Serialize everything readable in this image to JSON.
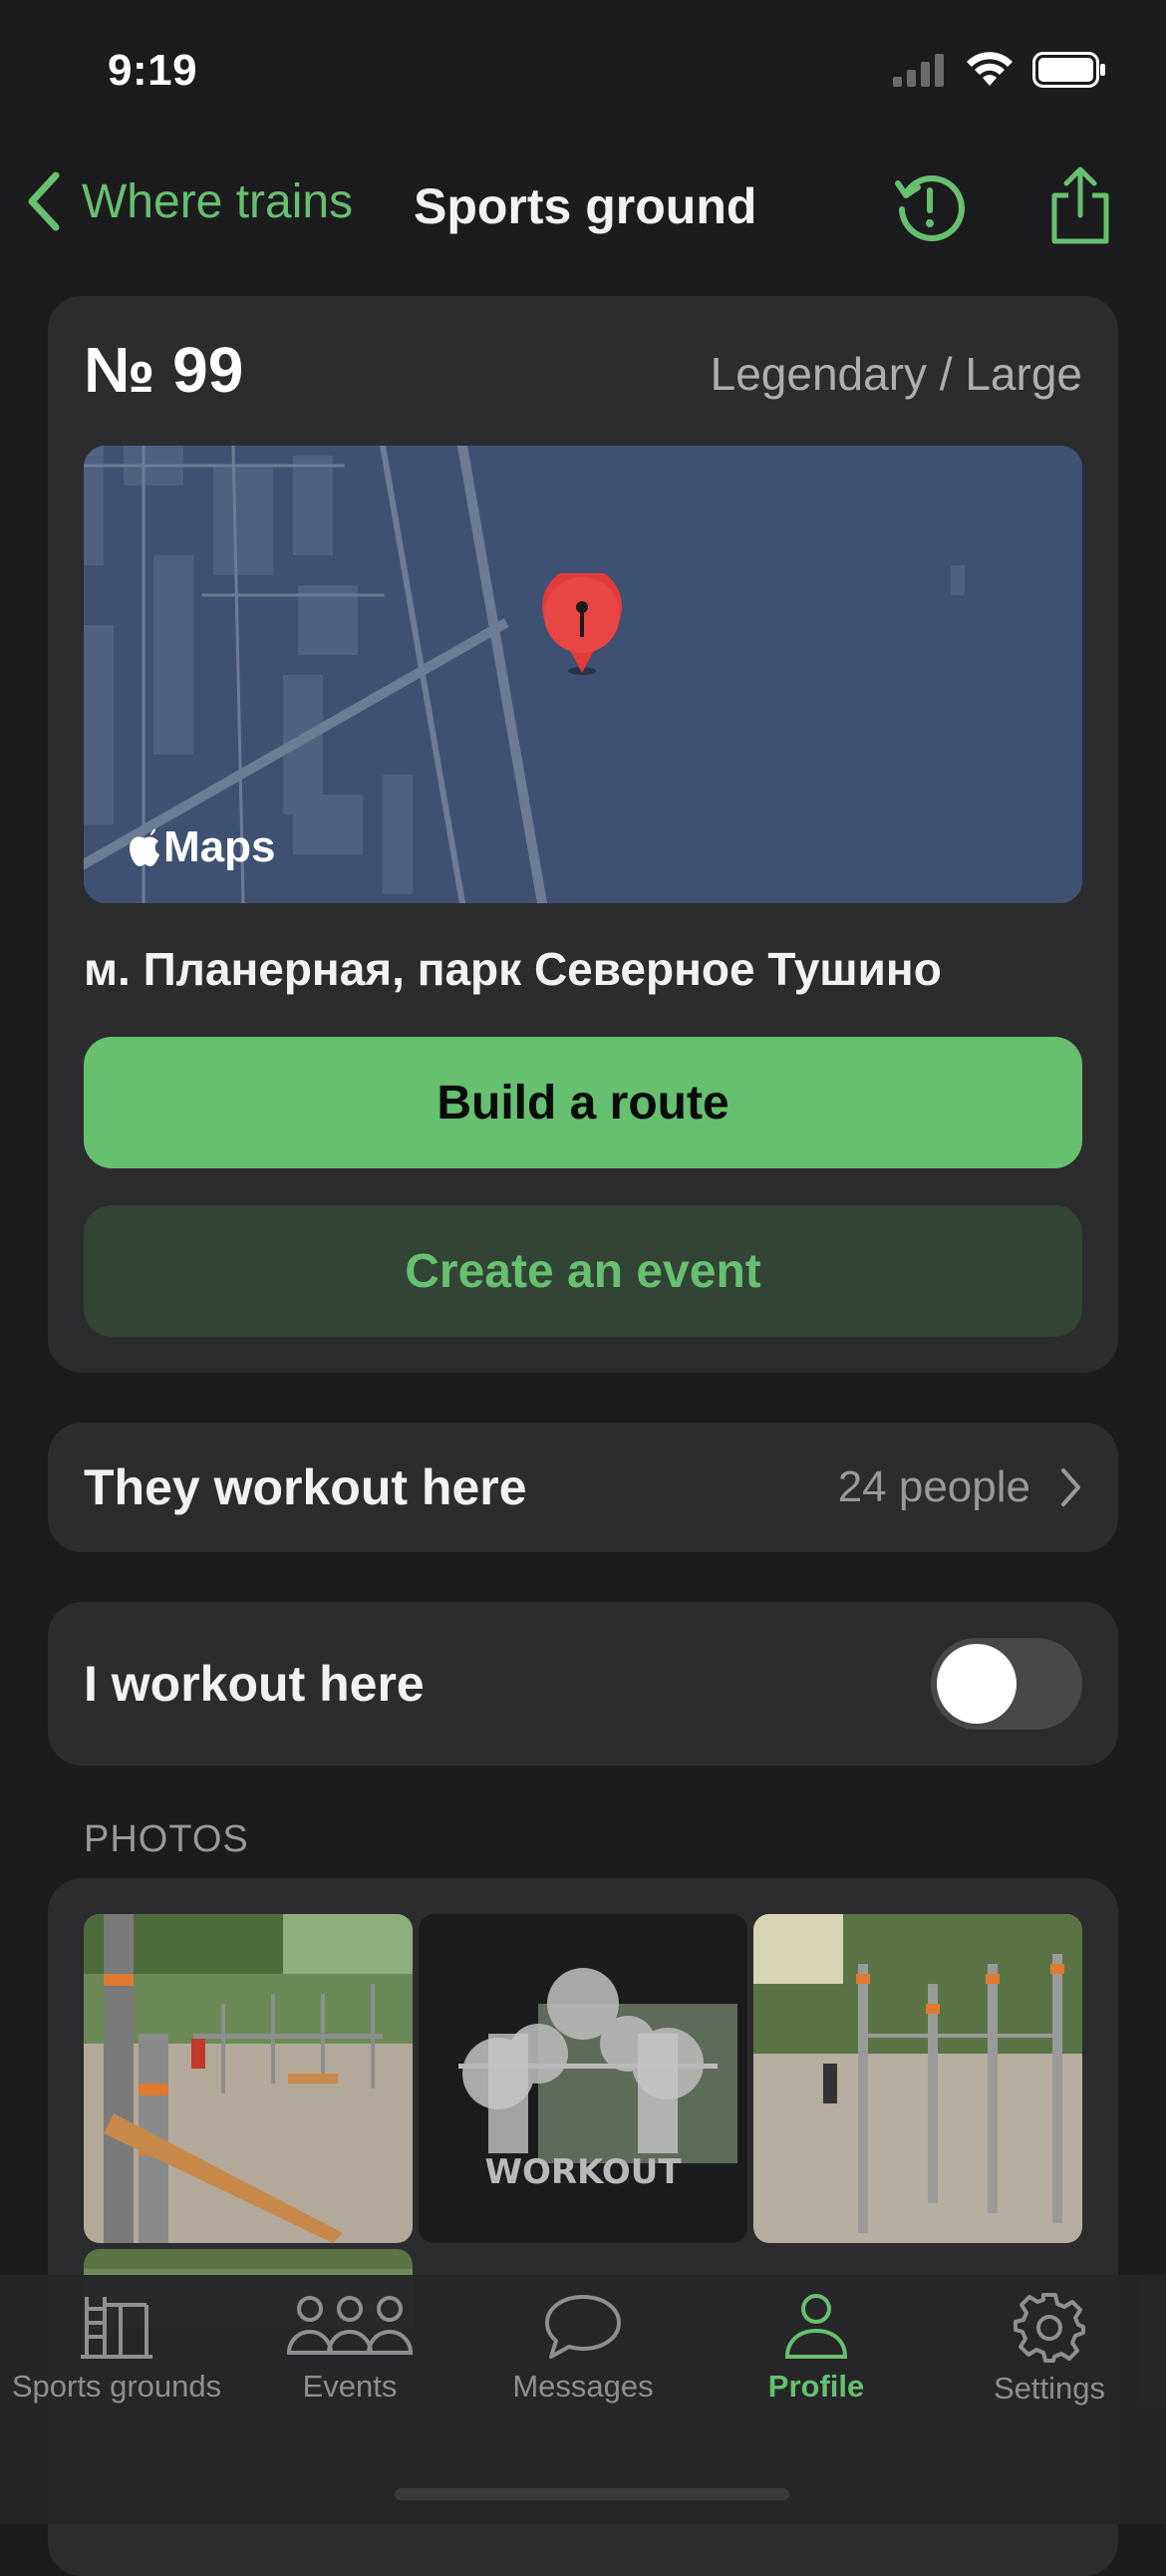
{
  "status_bar": {
    "time": "9:19",
    "icons": [
      "cellular-signal-icon",
      "wifi-icon",
      "battery-icon"
    ]
  },
  "nav": {
    "back_label": "Where trains",
    "title": "Sports ground",
    "actions": [
      "report-icon",
      "share-icon"
    ]
  },
  "ground": {
    "number": "№ 99",
    "grade": "Legendary / Large",
    "map_brand": "Maps",
    "address": "м. Планерная, парк Северное Тушино",
    "route_button": "Build a route",
    "event_button": "Create an event"
  },
  "workout_here": {
    "label": "They workout here",
    "count": "24 people"
  },
  "toggle": {
    "label": "I workout here",
    "on": false
  },
  "photos": {
    "header": "PHOTOS",
    "placeholder_logo_text": "WorkOut"
  },
  "tabs": [
    {
      "label": "Sports grounds",
      "icon": "ladder-icon",
      "active": false
    },
    {
      "label": "Events",
      "icon": "people-icon",
      "active": false
    },
    {
      "label": "Messages",
      "icon": "chat-bubble-icon",
      "active": false
    },
    {
      "label": "Profile",
      "icon": "person-icon",
      "active": true
    },
    {
      "label": "Settings",
      "icon": "gear-icon",
      "active": false
    }
  ],
  "colors": {
    "accent": "#66c06f",
    "background": "#1c1c1e",
    "card": "#2c2c2e",
    "map": "#3e5172",
    "pin": "#e23b3b"
  }
}
